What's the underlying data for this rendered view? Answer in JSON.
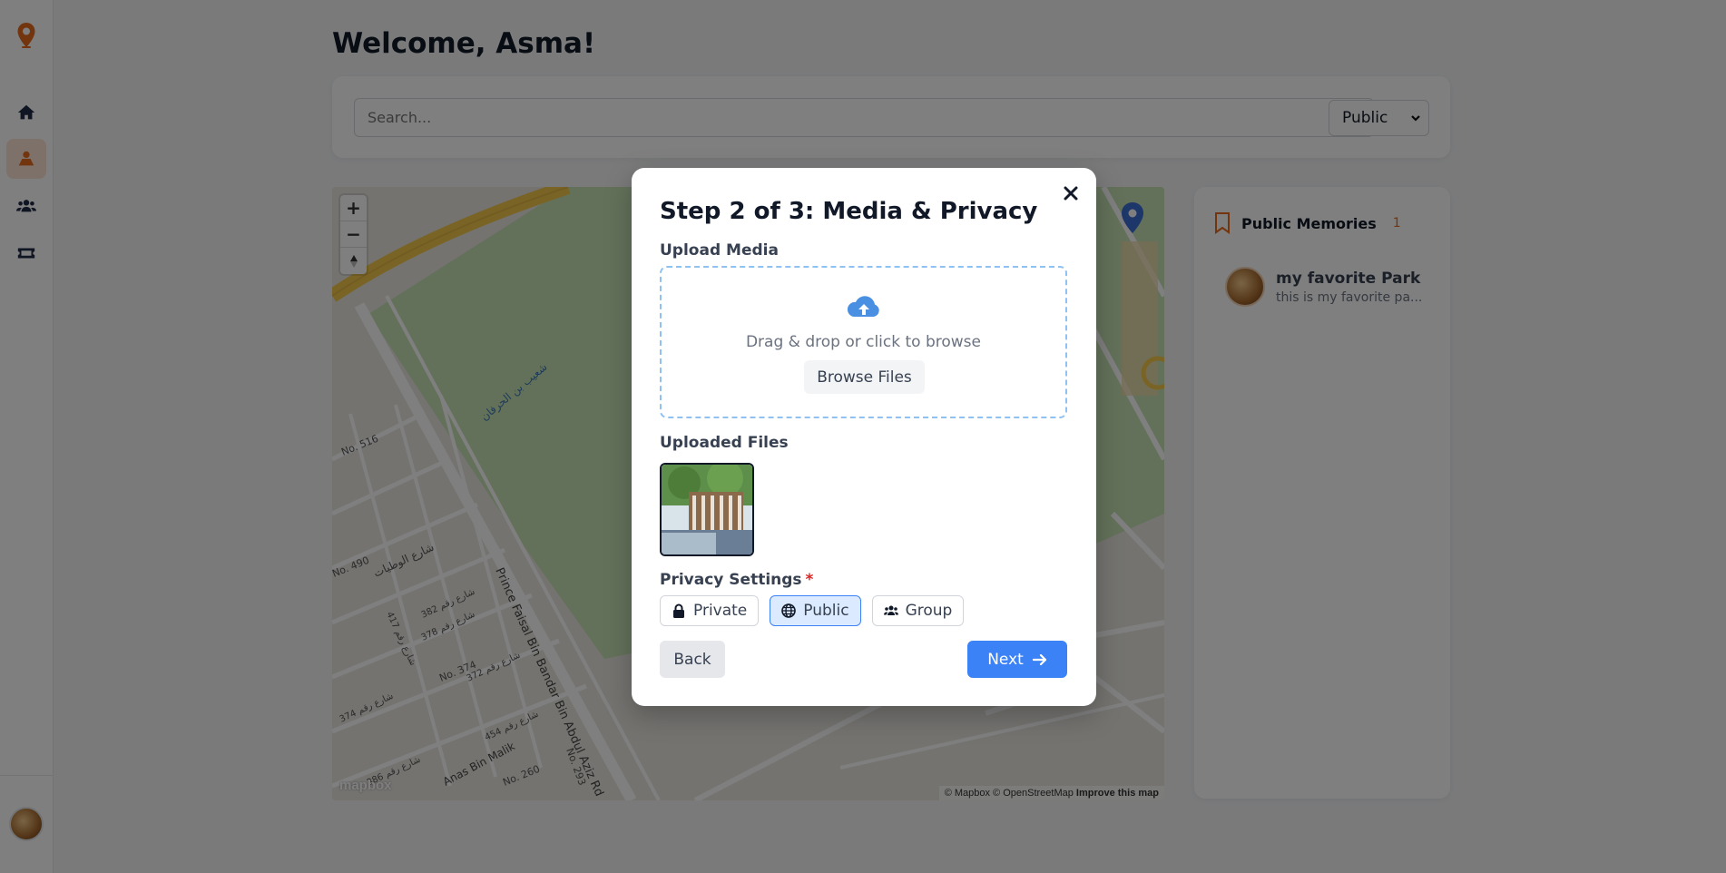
{
  "header": {
    "welcome": "Welcome, Asma!"
  },
  "search": {
    "placeholder": "Search...",
    "filter_value": "Public"
  },
  "sidebar": {
    "items": [
      {
        "name": "home",
        "icon": "home-icon"
      },
      {
        "name": "map",
        "icon": "map-user-icon"
      },
      {
        "name": "groups",
        "icon": "users-icon"
      },
      {
        "name": "tickets",
        "icon": "ticket-icon"
      }
    ]
  },
  "map": {
    "attribution": "© Mapbox © OpenStreetMap",
    "improve": "Improve this map",
    "logo": "mapbox",
    "labels": [
      "No. 516",
      "No. 490",
      "No. 374",
      "No. 260",
      "No. 293",
      "Prince Faisal Bin Bandar Bin Abdul Aziz Rd",
      "Anas Bin Malik",
      "شعيب بن الحرفان",
      "شارع الوطيات",
      "شارع رقم 382",
      "شارع رقم 378",
      "شارع رقم 417",
      "شارع رقم 372",
      "شارع رقم 374",
      "شارع رقم 454",
      "شارع رقم 386"
    ]
  },
  "memories": {
    "title": "Public Memories",
    "count": "1",
    "items": [
      {
        "name": "my favorite Park",
        "desc": "this is my favorite pa..."
      }
    ]
  },
  "modal": {
    "title": "Step 2 of 3: Media & Privacy",
    "upload_label": "Upload Media",
    "dropzone_text": "Drag & drop or click to browse",
    "browse_label": "Browse Files",
    "uploaded_label": "Uploaded Files",
    "privacy_label": "Privacy Settings",
    "required_mark": "*",
    "privacy_options": [
      "Private",
      "Public",
      "Group"
    ],
    "selected_privacy": "Public",
    "back_label": "Back",
    "next_label": "Next"
  },
  "colors": {
    "accent": "#e56a1c",
    "primary": "#3b82f6",
    "dashed": "#8fc1f2"
  }
}
